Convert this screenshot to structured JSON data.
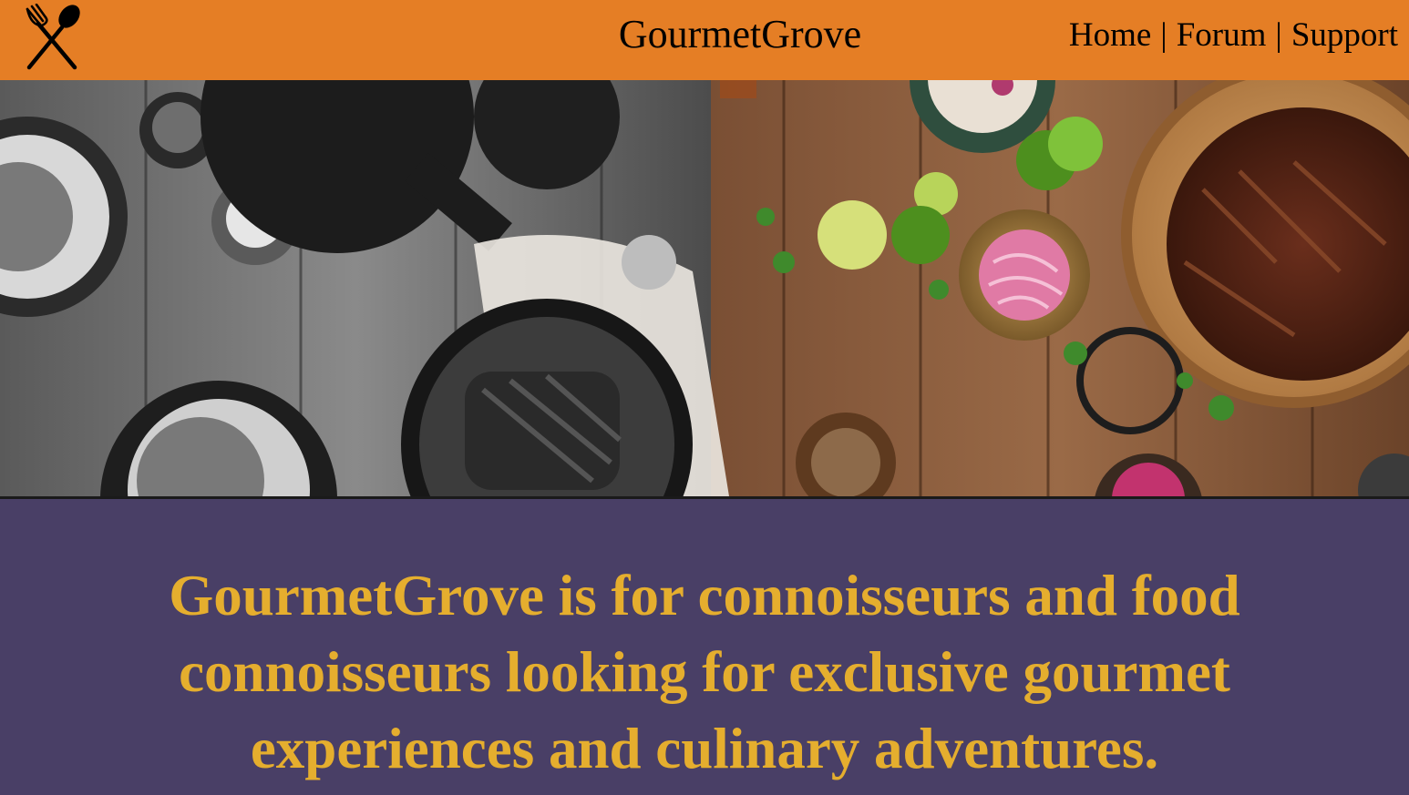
{
  "header": {
    "logo_icon": "fork-and-spoon-icon",
    "title": "GourmetGrove",
    "nav": [
      {
        "label": "Home"
      },
      {
        "label": "Forum"
      },
      {
        "label": "Support"
      }
    ],
    "nav_separator": "|",
    "background_color": "#E57E25"
  },
  "hero": {
    "image": "overhead rustic table with grilled steak, pulled meat, limes, pickled onions and herbs"
  },
  "about": {
    "tagline": "GourmetGrove is for connoisseurs and food connoisseurs looking for exclusive gourmet experiences and culinary adventures.",
    "background_color": "#493F66",
    "text_color": "#E5AE2E"
  }
}
